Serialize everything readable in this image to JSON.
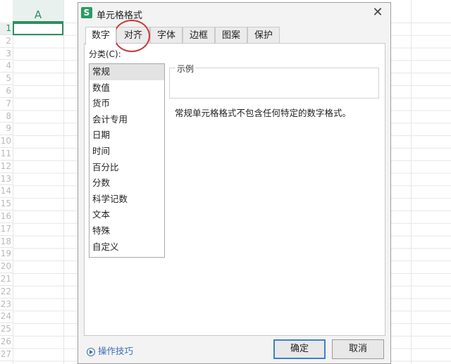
{
  "sheet": {
    "column_header": "A",
    "row_numbers": [
      "1",
      "2",
      "3",
      "4",
      "5",
      "6",
      "7",
      "8",
      "9",
      "10",
      "11",
      "12",
      "13",
      "14",
      "15",
      "16",
      "17",
      "18",
      "19",
      "20",
      "21",
      "22",
      "23",
      "24",
      "25",
      "26",
      "27"
    ]
  },
  "dialog": {
    "app_icon": "S",
    "title": "单元格格式",
    "close_icon": "✕",
    "tabs": [
      {
        "label": "数字",
        "active": true
      },
      {
        "label": "对齐",
        "active": false
      },
      {
        "label": "字体",
        "active": false
      },
      {
        "label": "边框",
        "active": false
      },
      {
        "label": "图案",
        "active": false
      },
      {
        "label": "保护",
        "active": false
      }
    ],
    "category_label": "分类(C):",
    "categories": [
      "常规",
      "数值",
      "货币",
      "会计专用",
      "日期",
      "时间",
      "百分比",
      "分数",
      "科学记数",
      "文本",
      "特殊",
      "自定义"
    ],
    "selected_category": "常规",
    "sample_legend": "示例",
    "description": "常规单元格格式不包含任何特定的数字格式。",
    "tips_link": "操作技巧",
    "ok_button": "确定",
    "cancel_button": "取消"
  },
  "colors": {
    "accent_green": "#2f8f62",
    "annotation_red": "#c83a3a",
    "link_blue": "#3b6fb8"
  }
}
